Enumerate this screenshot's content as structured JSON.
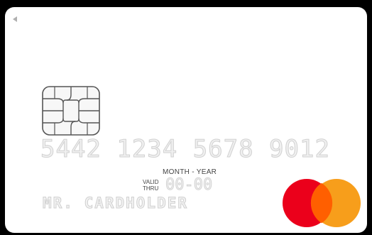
{
  "card": {
    "number": "5442 1234 5678 9012",
    "expiry_caption": "MONTH - YEAR",
    "valid_thru_line1": "VALID",
    "valid_thru_line2": "THRU",
    "expiry": "00-00",
    "cardholder": "MR. CARDHOLDER"
  },
  "icons": {
    "back": "back-arrow-icon",
    "chip": "emv-chip-icon",
    "network": "mastercard-logo-icon"
  },
  "colors": {
    "card_background": "#ffffff",
    "page_background": "#000000",
    "mastercard_red": "#eb001b",
    "mastercard_orange": "#f79e1b",
    "mastercard_overlap": "#ff5f00"
  }
}
